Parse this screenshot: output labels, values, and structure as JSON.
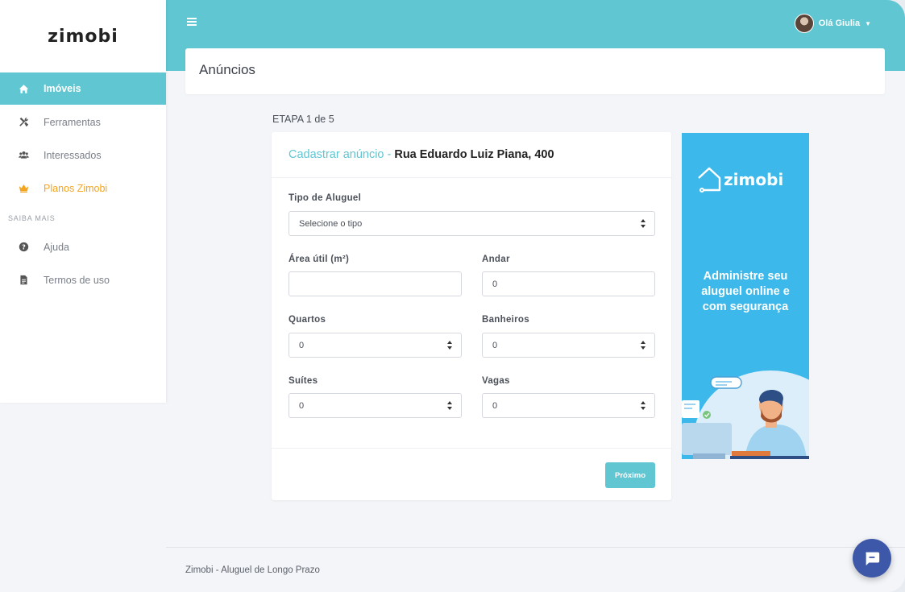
{
  "brand": {
    "name": "zimobi"
  },
  "sidebar": {
    "items": [
      {
        "label": "Imóveis",
        "icon": "home-icon"
      },
      {
        "label": "Ferramentas",
        "icon": "tools-icon"
      },
      {
        "label": "Interessados",
        "icon": "users-icon"
      },
      {
        "label": "Planos Zimobi",
        "icon": "crown-icon"
      }
    ],
    "section_label": "SAIBA MAIS",
    "section_items": [
      {
        "label": "Ajuda",
        "icon": "question-circle-icon"
      },
      {
        "label": "Termos de uso",
        "icon": "document-icon"
      }
    ]
  },
  "topbar": {
    "user_label": "Olá Giulia"
  },
  "header": {
    "title": "Anúncios"
  },
  "form": {
    "step": "ETAPA 1 de 5",
    "title_prefix": "Cadastrar anúncio -",
    "title_address": "Rua Eduardo Luiz Piana, 400",
    "tipo_label": "Tipo de Aluguel",
    "tipo_value": "Selecione o tipo",
    "area_label": "Área útil (m²)",
    "area_value": "",
    "andar_label": "Andar",
    "andar_value": "0",
    "quartos_label": "Quartos",
    "quartos_value": "0",
    "banheiros_label": "Banheiros",
    "banheiros_value": "0",
    "suites_label": "Suítes",
    "suites_value": "0",
    "vagas_label": "Vagas",
    "vagas_value": "0",
    "next_label": "Próximo"
  },
  "ad": {
    "logo_text": "zimobi",
    "line1": "Administre seu",
    "line2": "aluguel online e",
    "line3": "com segurança"
  },
  "footer": {
    "text": "Zimobi - Aluguel de Longo Prazo"
  },
  "colors": {
    "accent": "#5fc6d2",
    "plans": "#f4a41d",
    "ad_bg": "#3db8ea",
    "chat": "#3d58a8"
  }
}
